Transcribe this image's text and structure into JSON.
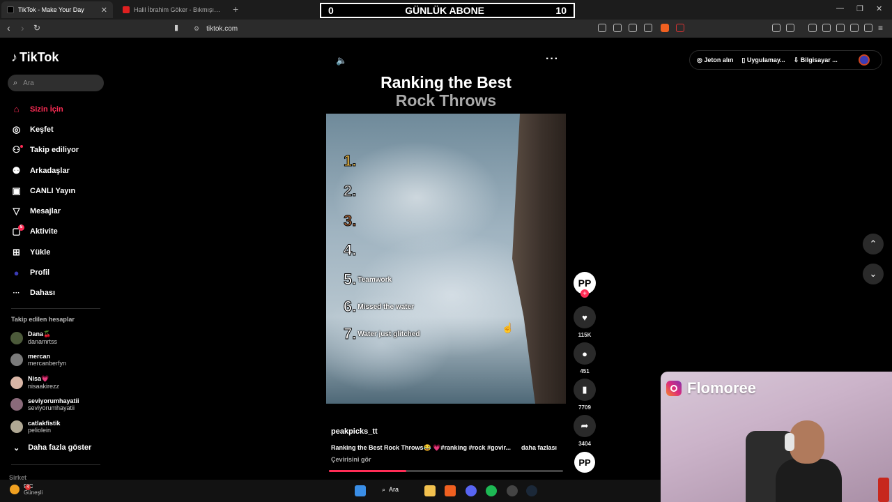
{
  "browser": {
    "tabs": [
      {
        "title": "TikTok - Make Your Day",
        "active": true
      },
      {
        "title": "Halil İbrahim Göker - Bıkmışım Dünya",
        "active": false
      }
    ],
    "url": "tiktok.com"
  },
  "overlay_counter": {
    "left": "0",
    "title": "GÜNLÜK ABONE",
    "right": "10"
  },
  "tiktok": {
    "logo": "TikTok",
    "search_placeholder": "Ara",
    "menu": [
      {
        "label": "Sizin İçin",
        "icon": "home-icon",
        "glyph": "⌂"
      },
      {
        "label": "Keşfet",
        "icon": "compass-icon",
        "glyph": "◎"
      },
      {
        "label": "Takip ediliyor",
        "icon": "following-icon",
        "glyph": "⚇"
      },
      {
        "label": "Arkadaşlar",
        "icon": "friends-icon",
        "glyph": "⚉"
      },
      {
        "label": "CANLI Yayın",
        "icon": "live-icon",
        "glyph": "▣"
      },
      {
        "label": "Mesajlar",
        "icon": "messages-icon",
        "glyph": "▽"
      },
      {
        "label": "Aktivite",
        "icon": "activity-icon",
        "glyph": "▢",
        "badge": "5"
      },
      {
        "label": "Yükle",
        "icon": "upload-icon",
        "glyph": "⊞"
      },
      {
        "label": "Profil",
        "icon": "profile-icon",
        "glyph": "●"
      },
      {
        "label": "Dahası",
        "icon": "more-icon",
        "glyph": "···"
      }
    ],
    "following_title": "Takip edilen hesaplar",
    "following": [
      {
        "name": "Dana🍒",
        "handle": "danamrtss"
      },
      {
        "name": "mercan",
        "handle": "mercanberfyn"
      },
      {
        "name": "Nisa💗",
        "handle": "nisaakirezz"
      },
      {
        "name": "seviyorumhayatii",
        "handle": "seviyorumhayatii"
      },
      {
        "name": "catlakfistik",
        "handle": "peliolein"
      }
    ],
    "show_more": "Daha fazla göster",
    "company": "Şirket",
    "top_right": {
      "coins": "Jeton alın",
      "app": "Uygulamay...",
      "desktop": "Bilgisayar ..."
    }
  },
  "video": {
    "title_line1": "Ranking the Best",
    "title_line2": "Rock Throws",
    "ranks": [
      {
        "num": "1.",
        "label": "",
        "color": "#f2c14e"
      },
      {
        "num": "2.",
        "label": "",
        "color": "#c8c8c8"
      },
      {
        "num": "3.",
        "label": "",
        "color": "#a0623a"
      },
      {
        "num": "4.",
        "label": "",
        "color": "#ffffff"
      },
      {
        "num": "5.",
        "label": "Teamwork",
        "color": "#ffffff"
      },
      {
        "num": "6.",
        "label": "Missed the water",
        "color": "#ffffff"
      },
      {
        "num": "7.",
        "label": "Water just glitched",
        "color": "#ffffff"
      }
    ],
    "author": "peakpicks_tt",
    "description": "Ranking the Best Rock Throws😂 💗#ranking #rock #govir...",
    "more_label": "daha fazlası",
    "translate": "Çevirisini gör",
    "progress": 0.33,
    "avatar_text": "PP",
    "likes": "115K",
    "comments": "451",
    "saves": "7709",
    "shares": "3404"
  },
  "webcam": {
    "label": "Flomoree"
  },
  "taskbar": {
    "temp": "9°C",
    "condition": "Güneşli",
    "weather_badge": "4",
    "search": "Ara"
  },
  "colors": {
    "accent": "#ff2c55"
  }
}
